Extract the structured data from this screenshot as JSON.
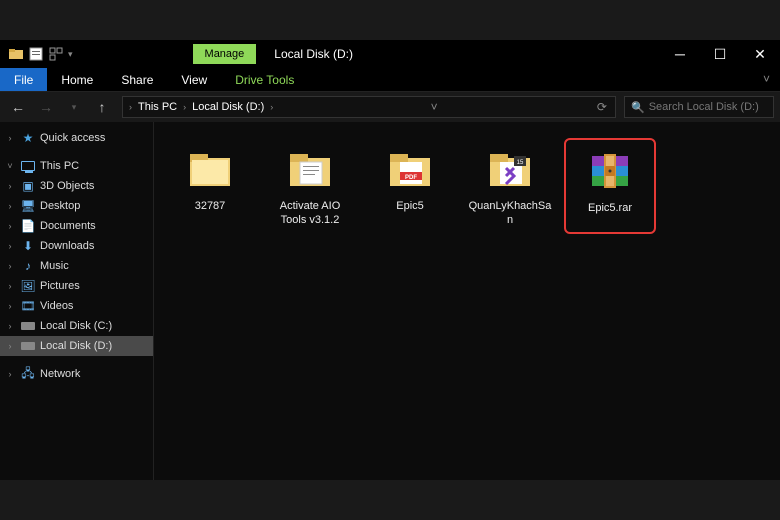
{
  "titlebar": {
    "manage_label": "Manage",
    "title": "Local Disk (D:)"
  },
  "ribbon": {
    "file": "File",
    "home": "Home",
    "share": "Share",
    "view": "View",
    "drive_tools": "Drive Tools"
  },
  "address": {
    "seg1": "This PC",
    "seg2": "Local Disk (D:)"
  },
  "search": {
    "placeholder": "Search Local Disk (D:)"
  },
  "sidebar": {
    "quick_access": "Quick access",
    "this_pc": "This PC",
    "objects3d": "3D Objects",
    "desktop": "Desktop",
    "documents": "Documents",
    "downloads": "Downloads",
    "music": "Music",
    "pictures": "Pictures",
    "videos": "Videos",
    "disk_c": "Local Disk (C:)",
    "disk_d": "Local Disk (D:)",
    "network": "Network"
  },
  "files": [
    {
      "name": "32787",
      "type": "folder"
    },
    {
      "name": "Activate AIO Tools v3.1.2",
      "type": "folder-docs"
    },
    {
      "name": "Epic5",
      "type": "folder-pdf"
    },
    {
      "name": "QuanLyKhachSan",
      "type": "folder-vs"
    },
    {
      "name": "Epic5.rar",
      "type": "rar",
      "highlighted": true
    }
  ]
}
